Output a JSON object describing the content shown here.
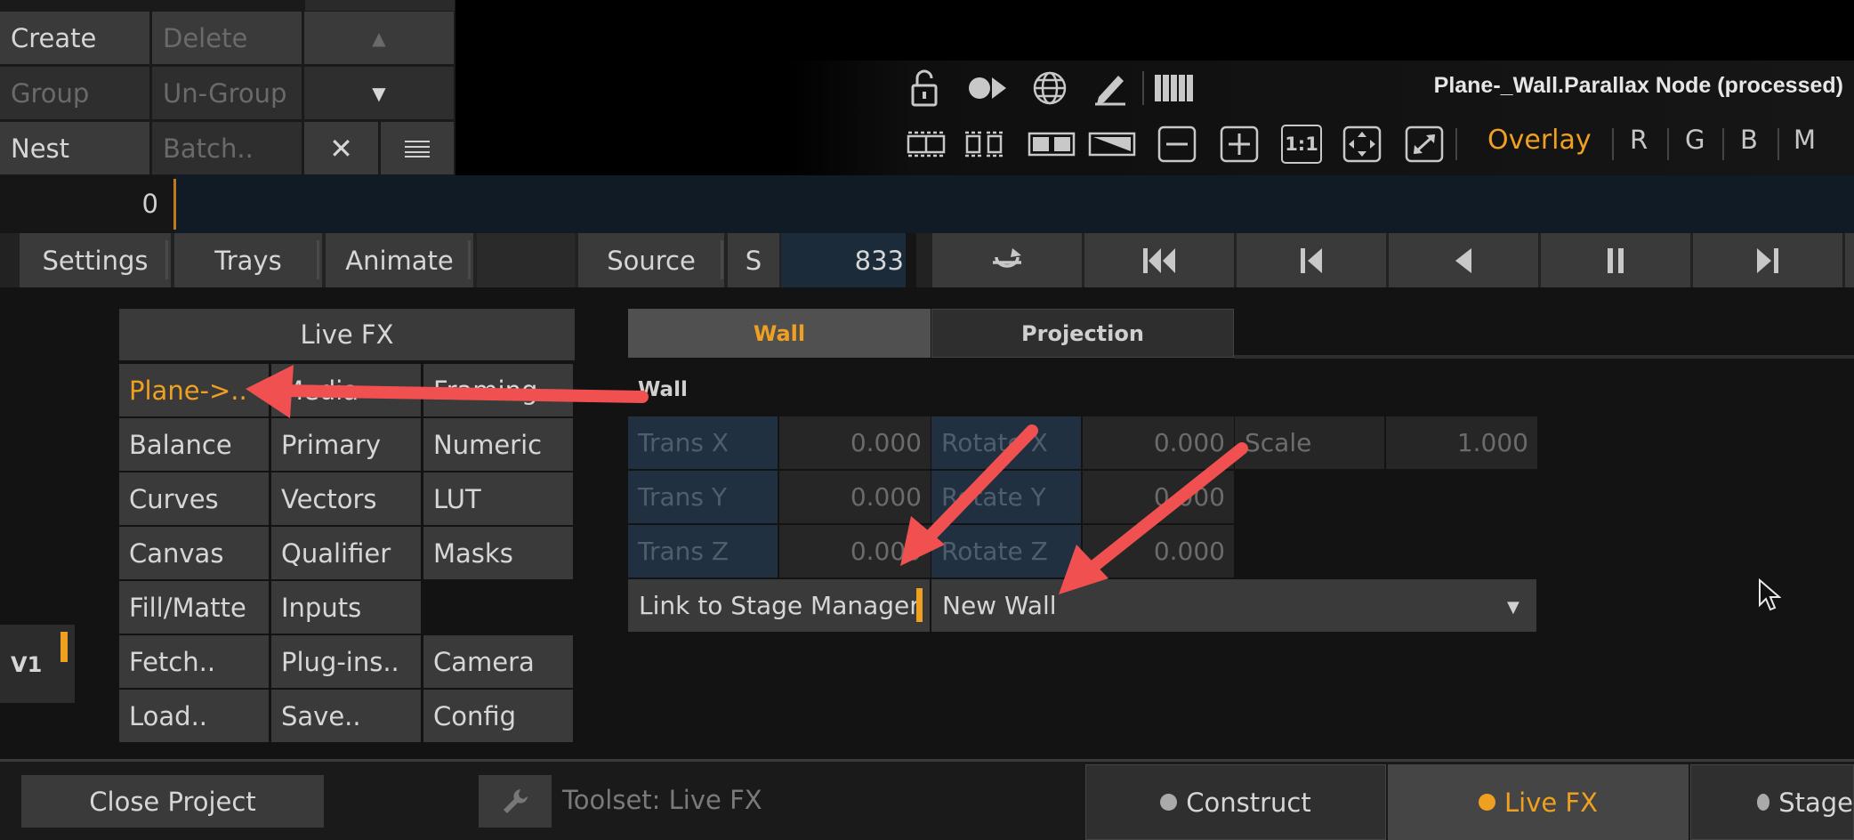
{
  "node_buttons": {
    "create": "Create",
    "delete": "Delete",
    "group": "Group",
    "ungroup": "Un-Group",
    "nest": "Nest",
    "batch": "Batch.."
  },
  "viewer": {
    "title": "Plane-_Wall.Parallax Node (processed)",
    "overlay": "Overlay",
    "channels": [
      "R",
      "G",
      "B",
      "M"
    ],
    "zoom_1_1": "1:1"
  },
  "timeline": {
    "frame": "0"
  },
  "toolbar": {
    "settings": "Settings",
    "trays": "Trays",
    "animate": "Animate",
    "source": "Source",
    "s": "S",
    "frame": "833"
  },
  "livefx": {
    "title": "Live FX",
    "items": [
      [
        "Plane->..",
        "Media",
        "Framing"
      ],
      [
        "Balance",
        "Primary",
        "Numeric"
      ],
      [
        "Curves",
        "Vectors",
        "LUT"
      ],
      [
        "Canvas",
        "Qualifier",
        "Masks"
      ],
      [
        "Fill/Matte",
        "Inputs",
        ""
      ],
      [
        "Fetch..",
        "Plug-ins..",
        "Camera"
      ],
      [
        "Load..",
        "Save..",
        "Config"
      ]
    ]
  },
  "wall_panel": {
    "tabs": [
      "Wall",
      "Projection"
    ],
    "section": "Wall",
    "trans_x_label": "Trans X",
    "trans_x": "0.000",
    "trans_y_label": "Trans Y",
    "trans_y": "0.000",
    "trans_z_label": "Trans Z",
    "trans_z": "0.000",
    "rot_x_label": "Rotate X",
    "rot_x": "0.000",
    "rot_y_label": "Rotate Y",
    "rot_y": "0.000",
    "rot_z_label": "Rotate Z",
    "rot_z": "0.000",
    "scale_label": "Scale",
    "scale": "1.000",
    "link_label": "Link to Stage Manager",
    "wall_select": "New Wall"
  },
  "layer_label": "V1",
  "bottom": {
    "close_project": "Close Project",
    "toolset": "Toolset: Live FX",
    "tabs": [
      "Construct",
      "Live FX",
      "Stage"
    ]
  },
  "colors": {
    "accent": "#f0a020",
    "arrow": "#f05050"
  }
}
